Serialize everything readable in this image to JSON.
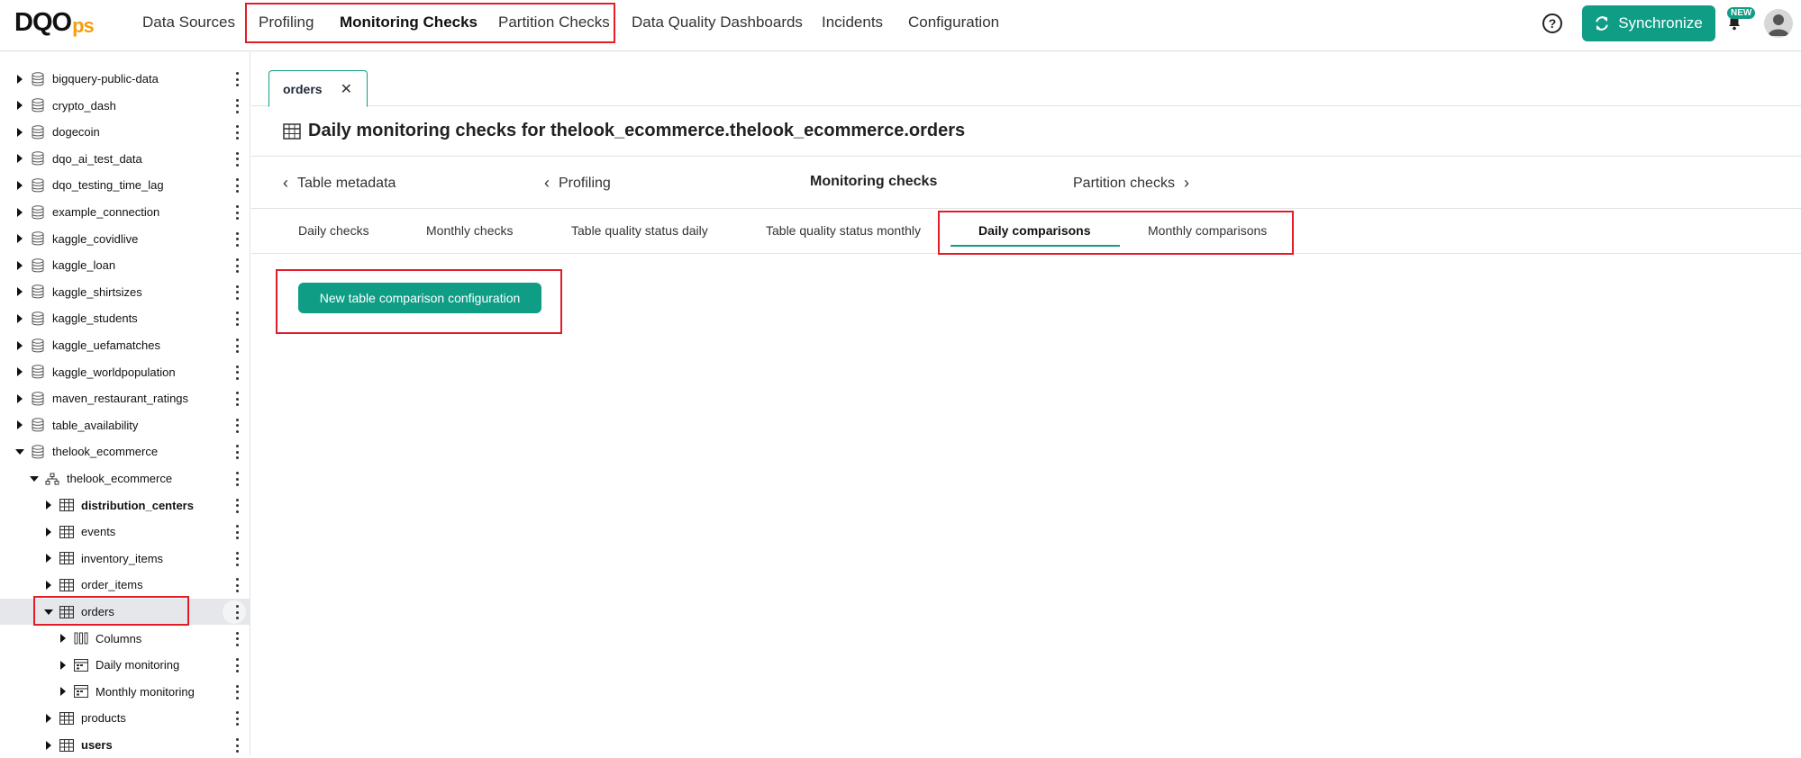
{
  "header": {
    "logo_main": "DQO",
    "logo_suffix": "ps",
    "nav": [
      {
        "label": "Data Sources"
      },
      {
        "label": "Profiling"
      },
      {
        "label": "Monitoring Checks"
      },
      {
        "label": "Partition Checks"
      },
      {
        "label": "Data Quality Dashboards"
      },
      {
        "label": "Incidents"
      },
      {
        "label": "Configuration"
      }
    ],
    "help_icon": "question-circle-icon",
    "sync_label": "Synchronize",
    "new_badge": "NEW",
    "accent_color": "#0f9d86",
    "highlight_color": "#e11d28"
  },
  "sidebar": {
    "items": [
      {
        "label": "bigquery-public-data"
      },
      {
        "label": "crypto_dash"
      },
      {
        "label": "dogecoin"
      },
      {
        "label": "dqo_ai_test_data"
      },
      {
        "label": "dqo_testing_time_lag"
      },
      {
        "label": "example_connection"
      },
      {
        "label": "kaggle_covidlive"
      },
      {
        "label": "kaggle_loan"
      },
      {
        "label": "kaggle_shirtsizes"
      },
      {
        "label": "kaggle_students"
      },
      {
        "label": "kaggle_uefamatches"
      },
      {
        "label": "kaggle_worldpopulation"
      },
      {
        "label": "maven_restaurant_ratings"
      },
      {
        "label": "table_availability"
      },
      {
        "label": "thelook_ecommerce"
      },
      {
        "label": "thelook_ecommerce"
      },
      {
        "label": "distribution_centers"
      },
      {
        "label": "events"
      },
      {
        "label": "inventory_items"
      },
      {
        "label": "order_items"
      },
      {
        "label": "orders"
      },
      {
        "label": "Columns"
      },
      {
        "label": "Daily monitoring"
      },
      {
        "label": "Monthly monitoring"
      },
      {
        "label": "products"
      },
      {
        "label": "users"
      }
    ]
  },
  "main": {
    "open_tab": "orders",
    "title": "Daily monitoring checks for thelook_ecommerce.thelook_ecommerce.orders",
    "section_nav": {
      "table_metadata": "Table metadata",
      "profiling": "Profiling",
      "monitoring_checks": "Monitoring checks",
      "partition_checks": "Partition checks"
    },
    "subtabs": [
      {
        "label": "Daily checks"
      },
      {
        "label": "Monthly checks"
      },
      {
        "label": "Table quality status daily"
      },
      {
        "label": "Table quality status monthly"
      },
      {
        "label": "Daily comparisons"
      },
      {
        "label": "Monthly comparisons"
      }
    ],
    "new_button": "New table comparison configuration"
  }
}
